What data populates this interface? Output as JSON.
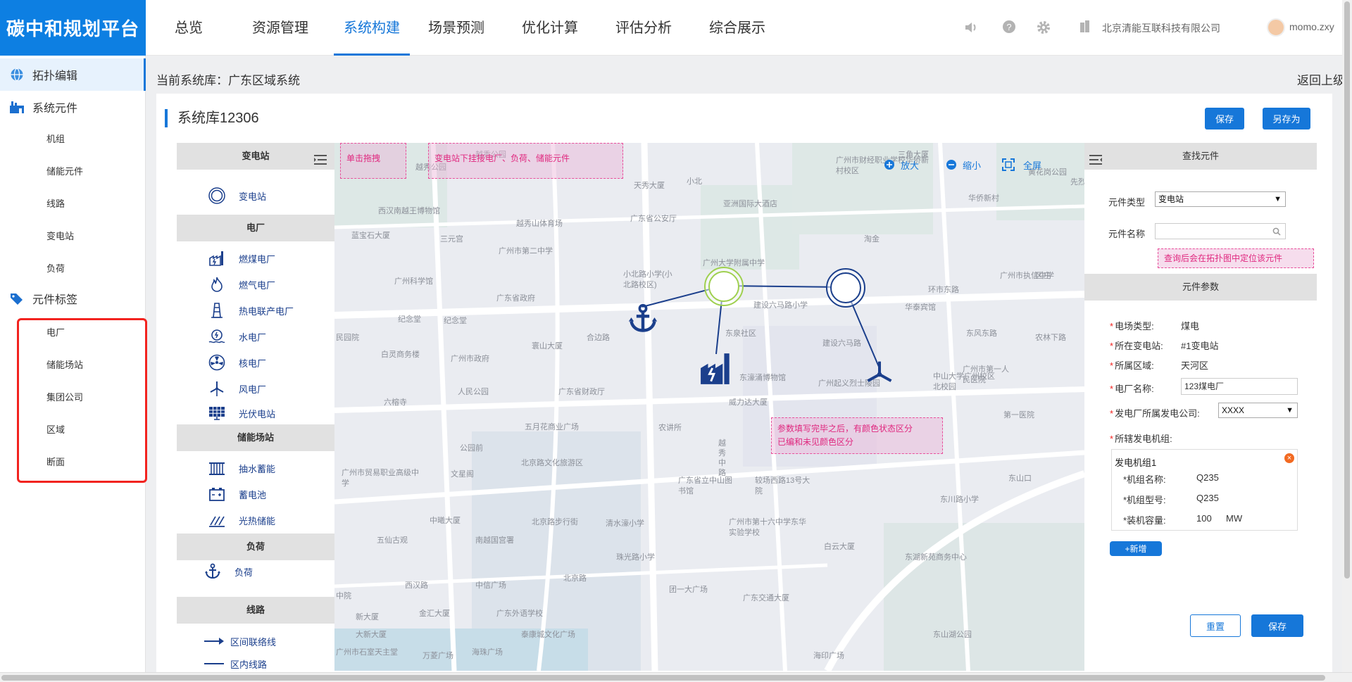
{
  "app": {
    "title": "碳中和规划平台"
  },
  "nav": {
    "tabs": [
      "总览",
      "资源管理",
      "系统构建",
      "场景预测",
      "优化计算",
      "评估分析",
      "综合展示"
    ],
    "active_tab": "系统构建",
    "company": "北京清能互联科技有限公司",
    "username": "momo.zxy"
  },
  "sidebar": {
    "group1": "拓扑编辑",
    "group2": "系统元件",
    "group2_items": [
      "机组",
      "储能元件",
      "线路",
      "变电站",
      "负荷"
    ],
    "group3": "元件标签",
    "group3_items": [
      "电厂",
      "储能场站",
      "集团公司",
      "区域",
      "断面"
    ]
  },
  "header": {
    "crumb": "当前系统库：广东区域系统",
    "back": "返回上级"
  },
  "panel": {
    "title": "系统库12306",
    "save": "保存",
    "save_as": "另存为"
  },
  "palette": {
    "sec_substation": "变电站",
    "substation": "变电站",
    "sec_plant": "电厂",
    "plants": [
      "燃煤电厂",
      "燃气电厂",
      "热电联产电厂",
      "水电厂",
      "核电厂",
      "风电厂",
      "光伏电站"
    ],
    "sec_storage": "储能场站",
    "storage": [
      "抽水蓄能",
      "蓄电池",
      "光热储能"
    ],
    "sec_load": "负荷",
    "load": "负荷",
    "sec_line": "线路",
    "lines": [
      "区间联络线",
      "区内线路"
    ]
  },
  "map": {
    "hint_drag": "单击拖拽",
    "hint_connect": "变电站下挂接电厂、负荷、储能元件",
    "hint_params_1": "参数填写完毕之后，有颜色状态区分",
    "hint_params_2": "已编和未见颜色区分",
    "zoom_in": "放大",
    "zoom_out": "缩小",
    "fullscreen": "全屏",
    "labels": [
      "越秀公园",
      "越秀公园",
      "西汉南越王博物馆",
      "蓝宝石大厦",
      "三元宫",
      "越秀山体育场",
      "广州市第二中学",
      "广州科学馆",
      "广东省政府",
      "小北路小学(小北路校区)",
      "广州大学附属中学",
      "亚洲国际大酒店",
      "天秀大厦",
      "广东省公安厅",
      "小北",
      "纪念堂",
      "纪念堂",
      "民园院",
      "白灵商务楼",
      "广州市政府",
      "寰山大厦",
      "合边路",
      "东泉社区",
      "建设六马路小学",
      "建设六马路",
      "人民公园",
      "广东省财政厅",
      "东濠涌博物馆",
      "威力达大厦",
      "广州起义烈士陵园",
      "中山大学广州校区北校园",
      "六榕寺",
      "五月花商业广场",
      "农讲所",
      "公园前",
      "北京路文化旅游区",
      "广州市贸易职业高级中学",
      "文星阁",
      "广东省立中山图书馆",
      "较场西路13号大院",
      "中曦大厦",
      "北京路步行街",
      "清水濠小学",
      "广州市第十六中学东华实验学校",
      "五仙古观",
      "南越国宫署",
      "越秀中路",
      "新大厦",
      "金汇大厦",
      "广东外语学校",
      "中信广场",
      "西汉路",
      "广州市执信中学",
      "广州市第一人民医院",
      "第一医院",
      "东山口",
      "东川路小学",
      "白云大厦",
      "东湖新苑商务中心",
      "东山湖公园",
      "海印广场",
      "广东交通大厦",
      "团一大广场",
      "珠光路小学",
      "北京路",
      "万菱广场",
      "海珠广场",
      "泰康城文化广场",
      "大新大厦",
      "广州市石室天主堂",
      "中院",
      "淘金",
      "环市东路",
      "区庄",
      "华泰宾馆",
      "东风东路",
      "农林下路",
      "三角大厦",
      "华侨新村",
      "广州市财经职业学校华侨新村校区",
      "黄花岗公园",
      "先烈"
    ]
  },
  "right": {
    "search_head": "查找元件",
    "type_label": "元件类型",
    "type_value": "变电站",
    "name_label": "元件名称",
    "name_placeholder": "",
    "search_hint": "查询后会在拓扑图中定位该元件",
    "params_head": "元件参数",
    "fields": [
      {
        "label": "电场类型:",
        "value": "煤电"
      },
      {
        "label": "所在变电站:",
        "value": "#1变电站"
      },
      {
        "label": "所属区域:",
        "value": "天河区"
      }
    ],
    "plant_name_label": "电厂名称:",
    "plant_name_value": "123煤电厂",
    "company_label": "发电厂所属发电公司:",
    "company_value": "XXXX",
    "units_label": "所辖发电机组:",
    "unit_title": "发电机组1",
    "unit_name_label": "*机组名称:",
    "unit_name_value": "Q235",
    "unit_model_label": "*机组型号:",
    "unit_model_value": "Q235",
    "unit_cap_label": "*装机容量:",
    "unit_cap_value": "100",
    "unit_cap_unit": "MW",
    "add": "+新增",
    "reset": "重置",
    "save": "保存"
  }
}
